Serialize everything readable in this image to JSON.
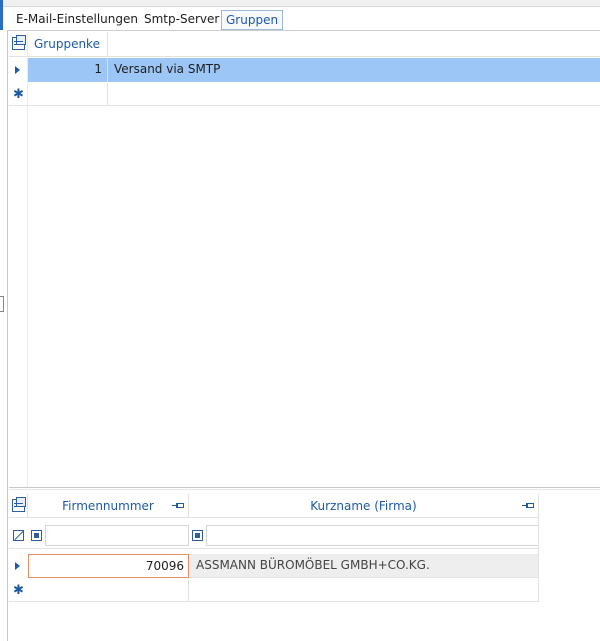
{
  "tabs": [
    {
      "label": "E-Mail-Einstellungen",
      "active": false
    },
    {
      "label": "Smtp-Server",
      "active": false
    },
    {
      "label": "Gruppen",
      "active": true
    }
  ],
  "groups_grid": {
    "columns": [
      "Gruppenke",
      ""
    ],
    "rows": [
      {
        "key": "1",
        "name": "Versand via SMTP",
        "selected": true
      }
    ]
  },
  "companies_grid": {
    "columns": [
      "Firmennummer",
      "Kurzname (Firma)"
    ],
    "filter": {
      "number": "",
      "name": ""
    },
    "rows": [
      {
        "number": "70096",
        "name": "ASSMANN BÜROMÖBEL GMBH+CO.KG."
      }
    ]
  },
  "colors": {
    "accent": "#1f5aa6",
    "selection": "#9cc6f5",
    "focus_border": "#e2906a"
  },
  "icons": [
    "grid-layout-icon",
    "row-indicator-arrow-icon",
    "new-row-star-icon",
    "pin-icon",
    "filter-icon",
    "checkbox-filter-icon"
  ]
}
